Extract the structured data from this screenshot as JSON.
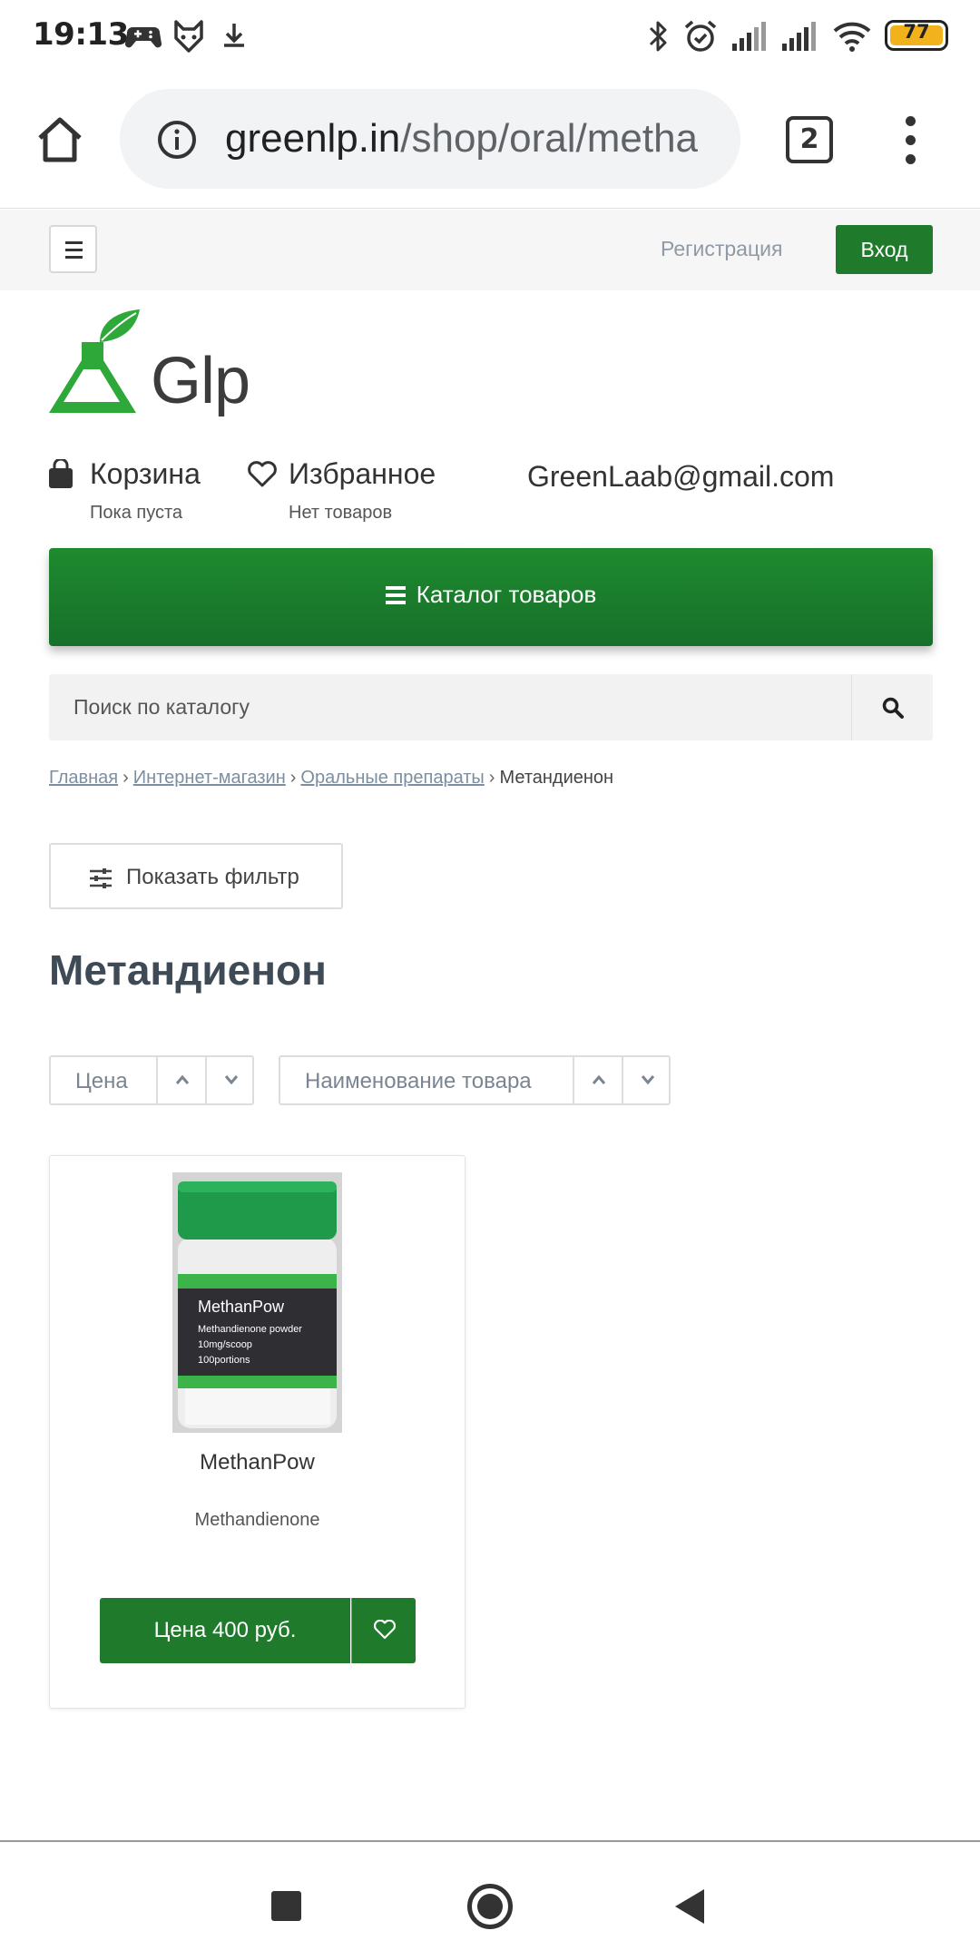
{
  "status_bar": {
    "time": "19:13",
    "battery": "77",
    "icons": [
      "gamepad-icon",
      "fox-icon",
      "download-icon",
      "bluetooth-icon",
      "alarm-icon",
      "signal-icon",
      "signal-icon",
      "wifi-icon",
      "battery-icon"
    ]
  },
  "browser": {
    "url_host": "greenlp.in",
    "url_path": "/shop/oral/metha",
    "tab_count": "2"
  },
  "site": {
    "register_label": "Регистрация",
    "login_label": "Вход",
    "logo_text": "Glp",
    "cart_title": "Корзина",
    "cart_sub": "Пока пуста",
    "favorites_title": "Избранное",
    "favorites_sub": "Нет товаров",
    "email": "GreenLaab@gmail.com",
    "catalog_label": "Каталог товаров",
    "search_placeholder": "Поиск по каталогу",
    "breadcrumb": [
      "Главная",
      "Интернет-магазин",
      "Оральные препараты",
      "Метандиенон"
    ],
    "filter_label": "Показать фильтр",
    "page_title": "Метандиенон",
    "sort_price": "Цена",
    "sort_name": "Наименование товара"
  },
  "product": {
    "name": "MethanPow",
    "description": "Methandienone",
    "price_label": "Цена 400 руб.",
    "label_name": "MethanPow",
    "label_lines": [
      "Methandienone powder",
      "10mg/scoop",
      "100portions"
    ]
  },
  "colors": {
    "brand_green": "#1f7a2c",
    "link_grey": "#7c8ea0",
    "battery_yellow": "#f2b21b"
  }
}
